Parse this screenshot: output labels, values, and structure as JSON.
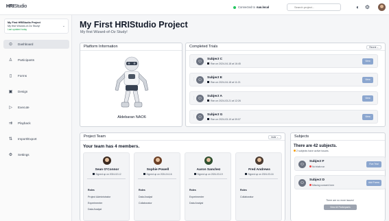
{
  "header": {
    "brand_bold": "HRI",
    "brand_light": "Studio",
    "connection_text": "Connected to",
    "connection_host": "nao.local",
    "search_placeholder": "Search project...",
    "colors": {
      "connected": "#22c55e"
    }
  },
  "sidebar": {
    "project": {
      "name": "My First HRIStudio Project",
      "description": "My first Wizard-of-Oz Study!",
      "status": "Last updated today"
    },
    "items": [
      {
        "label": "Dashboard",
        "icon": "clock-icon",
        "glyph": "⊙",
        "active": true
      },
      {
        "label": "Participants",
        "icon": "users-icon",
        "glyph": "♙"
      },
      {
        "label": "Forms",
        "icon": "document-icon",
        "glyph": "▯"
      },
      {
        "label": "Design",
        "icon": "design-icon",
        "glyph": "▣"
      },
      {
        "label": "Execute",
        "icon": "play-icon",
        "glyph": "▷"
      },
      {
        "label": "Playback",
        "icon": "playback-icon",
        "glyph": "⇉"
      },
      {
        "label": "Import/Export",
        "icon": "import-export-icon",
        "glyph": "⇅"
      },
      {
        "label": "Settings",
        "icon": "gear-icon",
        "glyph": "⚙"
      }
    ]
  },
  "main": {
    "title": "My First HRIStudio Project",
    "subtitle": "My first Wizard-of-Oz Study!"
  },
  "platform": {
    "title": "Platform Information",
    "robot_name": "Aldebaran NAO6"
  },
  "trials": {
    "title": "Completed Trials",
    "filter_label": "Recent",
    "view_label": "View",
    "items": [
      {
        "subject": "Subject C",
        "date": "Ran on 2024-04-18 at 16:45"
      },
      {
        "subject": "Subject E",
        "date": "Ran on 2024-04-18 at 11:21"
      },
      {
        "subject": "Subject A",
        "date": "Ran on 2024-03-21 at 12:26"
      },
      {
        "subject": "Subject G",
        "date": "Ran on 2024-03-19 at 09:07"
      }
    ]
  },
  "team": {
    "title": "Project Team",
    "invite_label": "Invite",
    "summary": "Your team has 4 members.",
    "roles_label": "Roles",
    "members": [
      {
        "name": "Sean O'Connor",
        "joined": "Signed up on 2024-02-12",
        "roles": [
          "Project Administrator",
          "Experimenter",
          "Data Analyst"
        ],
        "hair": "#3b2a20"
      },
      {
        "name": "Sophie Powell",
        "joined": "Signed up on 2024-04-16",
        "roles": [
          "Data Analyst",
          "Collaborator"
        ],
        "hair": "#6b3f25"
      },
      {
        "name": "Aaron Sanchez",
        "joined": "Signed up on 2024-03-19",
        "roles": [
          "Experimenter",
          "Data Analyst"
        ],
        "hair": "#2f4f2f"
      },
      {
        "name": "Fred Andrews",
        "joined": "Signed up on 2024-03-16",
        "roles": [
          "Collaborator"
        ],
        "hair": "#4a3a30"
      }
    ]
  },
  "subjects": {
    "title": "Subjects",
    "count_text": "There are 42 subjects.",
    "issues_text": "2 subjects have active issues.",
    "items": [
      {
        "name": "Subject F",
        "status": "No trials run",
        "action": "Run Trial"
      },
      {
        "name": "Subject D",
        "status": "Missing consent form",
        "action": "Add Forms"
      }
    ],
    "no_more": "There are no more issues!",
    "view_all": "View All Participants"
  }
}
